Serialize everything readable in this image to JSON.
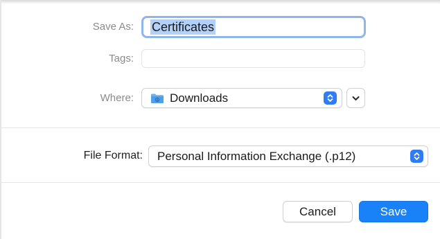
{
  "labels": {
    "save_as": "Save As:",
    "tags": "Tags:",
    "where": "Where:",
    "file_format": "File Format:"
  },
  "fields": {
    "save_as_value": "Certificates",
    "tags_value": ""
  },
  "where": {
    "selected": "Downloads",
    "icon": "folder-icon"
  },
  "file_format": {
    "selected": "Personal Information Exchange (.p12)"
  },
  "buttons": {
    "cancel": "Cancel",
    "save": "Save"
  },
  "colors": {
    "accent": "#1a82f8",
    "selection": "#b3d1f6",
    "focus_ring": "#8fb5ea"
  }
}
